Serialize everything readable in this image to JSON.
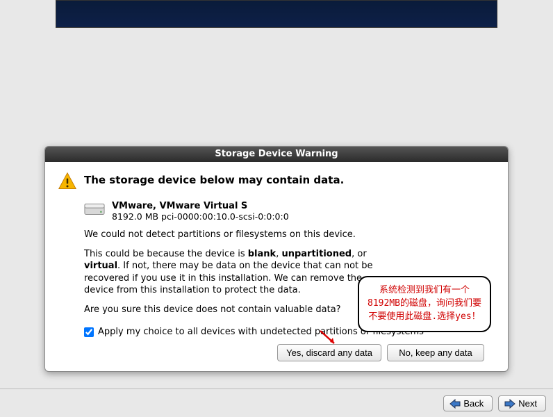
{
  "dialog": {
    "title": "Storage Device Warning",
    "heading": "The storage device below may contain data.",
    "device": {
      "name": "VMware, VMware Virtual S",
      "detail": "8192.0 MB pci-0000:00:10.0-scsi-0:0:0:0"
    },
    "para1": "We could not detect partitions or filesystems on this device.",
    "para2_a": "This could be because the device is ",
    "para2_b_blank": "blank",
    "para2_c": ", ",
    "para2_d_unpart": "unpartitioned",
    "para2_e": ", or ",
    "para2_f_virtual": "virtual",
    "para2_g": ". If not, there may be data on the device that can not be recovered if you use it in this installation. We can remove the device from this installation to protect the data.",
    "para3": "Are you sure this device does not contain valuable data?",
    "checkbox_label": "Apply my choice to all devices with undetected partitions or filesystems",
    "checkbox_checked": true,
    "btn_yes": "Yes, discard any data",
    "btn_no": "No, keep any data"
  },
  "annotation": {
    "line1": "系统检测到我们有一个",
    "line2": "8192MB的磁盘，询问我们要",
    "line3": "不要使用此磁盘.选择yes！"
  },
  "nav": {
    "back": "Back",
    "next": "Next"
  }
}
